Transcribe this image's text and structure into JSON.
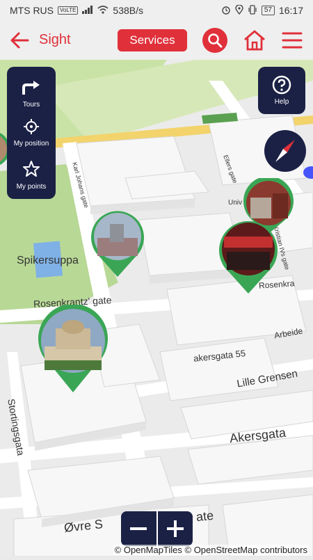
{
  "status_bar": {
    "carrier": "MTS RUS",
    "network_badge": "VoLTE",
    "speed": "538B/s",
    "battery": "57",
    "time": "16:17"
  },
  "app_bar": {
    "title": "Sight",
    "services_label": "Services"
  },
  "tools": [
    {
      "label": "Tours",
      "icon": "route-icon"
    },
    {
      "label": "My position",
      "icon": "crosshair-icon"
    },
    {
      "label": "My points",
      "icon": "star-icon"
    }
  ],
  "help": {
    "label": "Help"
  },
  "map_labels": {
    "park": "Spikersuppa",
    "rosenkrantz": "Rosenkrantz' gate",
    "rosenkra": "Rosenkra",
    "stortingsgata": "Stortingsgata",
    "akersgata55": "akersgata 55",
    "arbeide": "Arbeide",
    "lille_grensen": "Lille Grensen",
    "akersgata": "Akersgata",
    "ovre": "Øvre S",
    "ate": "ate",
    "karl_johans": "Karl Johans gate",
    "kristian": "Kristian IVs gate",
    "ellers": "Ellers gate",
    "univ": "Univ"
  },
  "attribution": "© OpenMapTiles © OpenStreetMap contributors",
  "colors": {
    "accent_red": "#e0303a",
    "panel_navy": "#1b2145",
    "pin_green": "#3aa655",
    "park_green": "#c9e2a6",
    "road_yellow": "#f3d36b"
  }
}
